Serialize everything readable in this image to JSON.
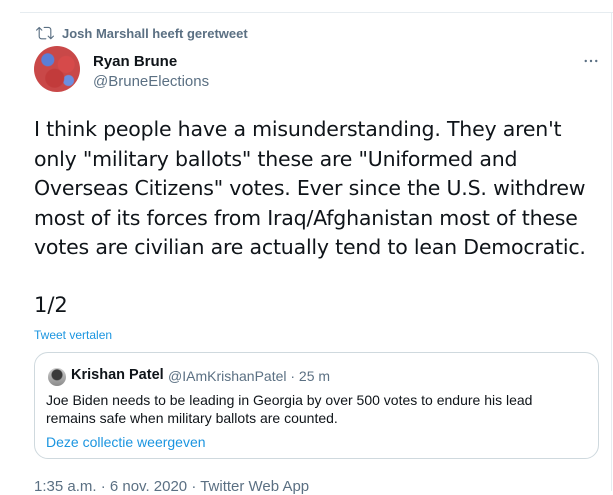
{
  "retweet_banner": {
    "icon": "retweet-icon",
    "text": "Josh Marshall heeft geretweet"
  },
  "author": {
    "name": "Ryan Brune",
    "handle": "@BruneElections"
  },
  "tweet": {
    "lines": [
      "I think people have a misunderstanding. They aren't",
      "only \"military ballots\" these are \"Uniformed and",
      "Overseas Citizens\" votes. Ever since the U.S. withdrew",
      "most of its forces from Iraq/Afghanistan most of these",
      "votes are civilian are actually tend to lean Democratic."
    ],
    "thread_counter": "1/2",
    "translate_label": "Tweet vertalen"
  },
  "quoted_tweet": {
    "name": "Krishan Patel",
    "handle_time": "@IAmKrishanPatel · 25 m",
    "lines": [
      "Joe Biden needs to be leading in Georgia by over 500 votes to endure his lead",
      "remains safe when military ballots are counted."
    ],
    "link_label": "Deze collectie weergeven"
  },
  "meta": {
    "timestamp": "1:35 a.m. · 6 nov. 2020 · Twitter Web App"
  },
  "colors": {
    "link": "#1b95e0",
    "secondary": "#5b7083",
    "border": "#cfd9de"
  }
}
